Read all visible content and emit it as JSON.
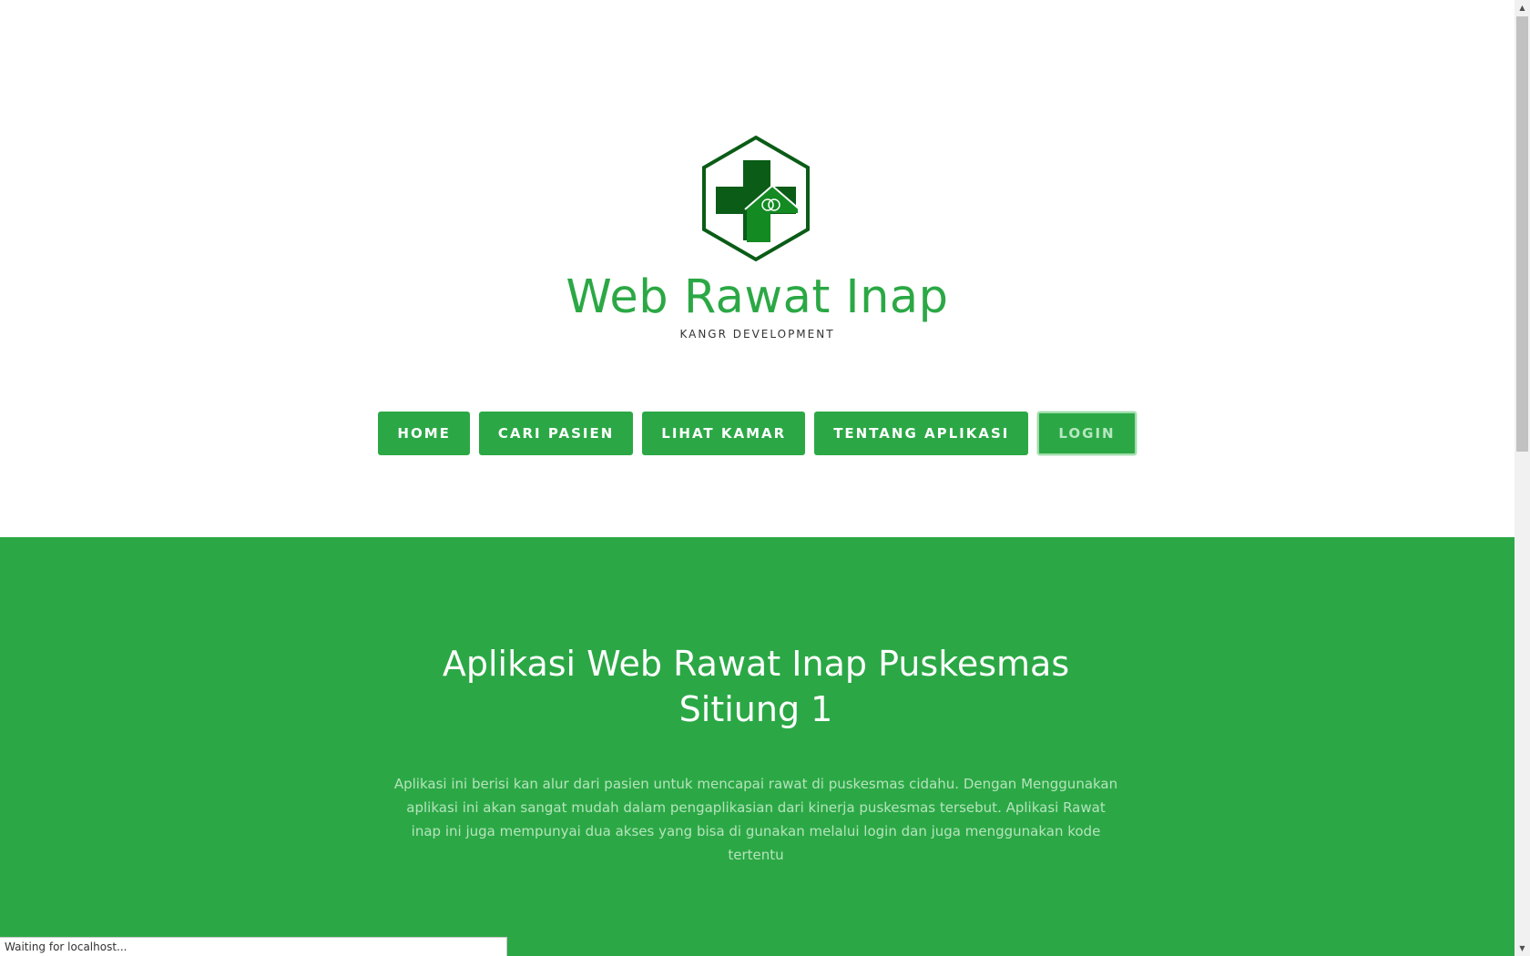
{
  "header": {
    "title": "Web Rawat Inap",
    "subtitle": "KANGR DEVELOPMENT",
    "logo_icon": "puskesmas-logo-icon"
  },
  "nav": {
    "items": [
      {
        "label": "HOME"
      },
      {
        "label": "CARI PASIEN"
      },
      {
        "label": "LIHAT KAMAR"
      },
      {
        "label": "TENTANG APLIKASI"
      },
      {
        "label": "LOGIN"
      }
    ],
    "active_index": 4
  },
  "hero": {
    "title": "Aplikasi Web Rawat Inap Puskesmas Sitiung 1",
    "description": "Aplikasi ini berisi kan alur dari pasien untuk mencapai rawat di puskesmas cidahu. Dengan Menggunakan aplikasi ini akan sangat mudah dalam pengaplikasian dari kinerja puskesmas tersebut. Aplikasi Rawat inap ini juga mempunyai dua akses yang bisa di gunakan melalui login dan juga menggunakan kode tertentu"
  },
  "status_bar": {
    "text": "Waiting for localhost..."
  },
  "colors": {
    "brand_green": "#2ba845",
    "logo_dark_green": "#0a5c16",
    "logo_mid_green": "#138a22"
  }
}
